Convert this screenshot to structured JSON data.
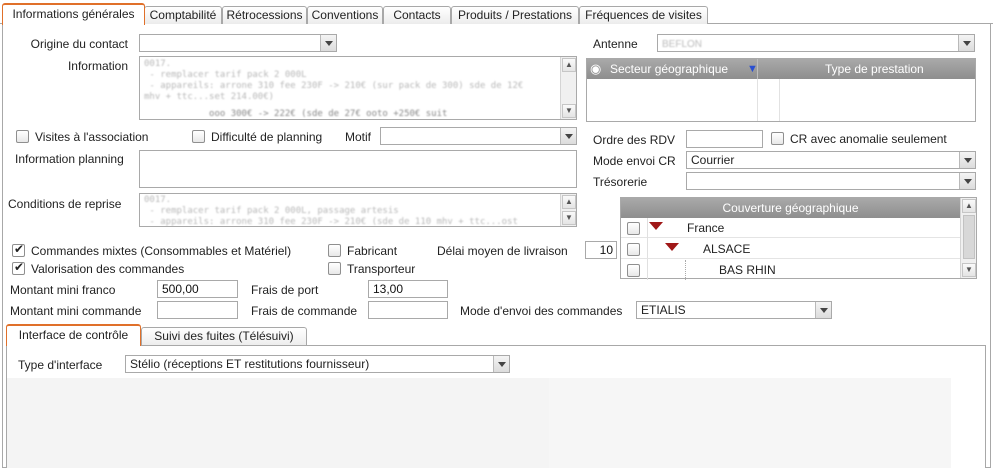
{
  "tabs": [
    "Informations générales",
    "Comptabilité",
    "Rétrocessions",
    "Conventions",
    "Contacts",
    "Produits / Prestations",
    "Fréquences de visites"
  ],
  "form": {
    "origine_label": "Origine du contact",
    "origine_value": "",
    "information_label": "Information",
    "information_text": "0017.\n - remplacer tarif pack 2 000L\n - appareils: arrone 310 fee 230F -> 210€ (sur pack de 300) sde de 12€\nmhv + ttc...set 214.00€)",
    "information_text2": "            ooo 300€ -> 222€ (sde de 27€ ooto +250€ suit",
    "visites_label": "Visites à l'association",
    "difficulte_label": "Difficulté de planning",
    "motif_label": "Motif",
    "motif_value": "",
    "info_planning_label": "Information planning",
    "conditions_label": "Conditions de reprise",
    "conditions_text": "0017.\n - remplacer tarif pack 2 000L, passage artesis\n - appareils: arrone 310 fee 230F -> 210€ (sde de 110 mhv + ttc...ost",
    "commandes_mixtes_label": "Commandes mixtes (Consommables et Matériel)",
    "fabricant_label": "Fabricant",
    "delai_label": "Délai moyen de livraison",
    "delai_value": "10",
    "valorisation_label": "Valorisation des commandes",
    "transporteur_label": "Transporteur",
    "montant_franco_label": "Montant mini franco",
    "montant_franco_value": "500,00",
    "frais_port_label": "Frais de port",
    "frais_port_value": "13,00",
    "montant_commande_label": "Montant mini commande",
    "montant_commande_value": "",
    "frais_commande_label": "Frais de commande",
    "frais_commande_value": "",
    "mode_envoi_cmd_label": "Mode d'envoi des commandes",
    "mode_envoi_cmd_value": "ETIALIS"
  },
  "right": {
    "antenne_label": "Antenne",
    "antenne_value": "BEFLON",
    "secteur_col": "Secteur géographique",
    "prestation_col": "Type de prestation",
    "ordre_rdv_label": "Ordre des RDV",
    "ordre_rdv_value": "",
    "cr_anomalie_label": "CR avec anomalie seulement",
    "mode_envoi_cr_label": "Mode envoi CR",
    "mode_envoi_cr_value": "Courrier",
    "tresorerie_label": "Trésorerie",
    "tresorerie_value": "",
    "couverture_header": "Couverture géographique",
    "couverture_rows": [
      "France",
      "ALSACE",
      "BAS RHIN"
    ]
  },
  "subtabs": [
    "Interface de contrôle",
    "Suivi des fuites (Télésuivi)"
  ],
  "interface": {
    "type_label": "Type d'interface",
    "type_value": "Stélio (réceptions ET restitutions fournisseur)"
  },
  "colors": {
    "accent": "#e0702a",
    "header_grey": "#9b9b9b",
    "tree_arrow": "#a01818"
  }
}
